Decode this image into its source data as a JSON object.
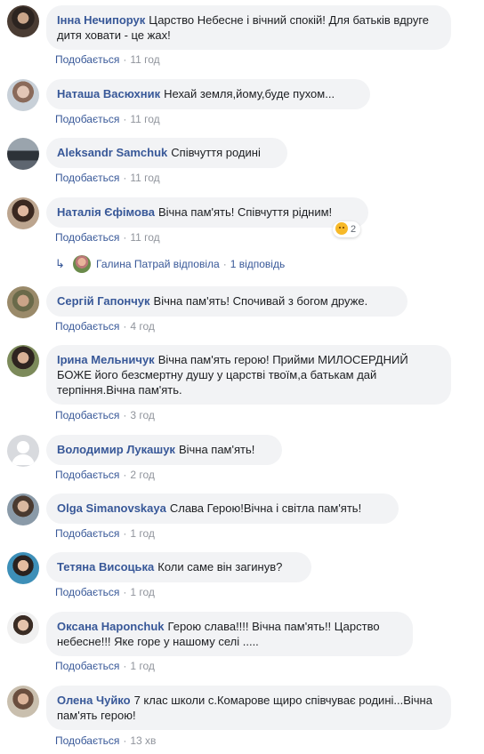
{
  "like_label": "Подобається",
  "separator": "·",
  "comments": [
    {
      "author": "Інна Нечипорук",
      "text": "Царство Небесне і вічний спокій! Для батьків вдруге дитя ховати - це жах!",
      "time": "11 год",
      "avatar": "avatar-inna"
    },
    {
      "author": "Наташа Васюхник",
      "text": "Нехай земля,йому,буде пухом...",
      "time": "11 год",
      "avatar": "avatar-natasha"
    },
    {
      "author": "Aleksandr Samchuk",
      "text": "Співчуття родині",
      "time": "11 год",
      "avatar": "avatar-aleksandr"
    },
    {
      "author": "Наталія Єфімова",
      "text": "Вічна пам'ять! Співчуття рідним!",
      "time": "11 год",
      "avatar": "avatar-natalia",
      "reactions": "2",
      "reaction_icon": "sad-face-icon"
    },
    {
      "author": "Сергій Гапончук",
      "text": "Вічна пам'ять! Спочивай з богом друже.",
      "time": "4 год",
      "avatar": "avatar-serhii"
    },
    {
      "author": "Ірина Мельничук",
      "text": "Вічна пам'ять герою! Прийми МИЛОСЕРДНИЙ БОЖЕ його безсмертну душу у царстві твоїм,а батькам дай терпіння.Вічна пам'ять.",
      "time": "3 год",
      "avatar": "avatar-iryna"
    },
    {
      "author": "Володимир Лукашук",
      "text": "Вічна пам'ять!",
      "time": "2 год",
      "avatar": "avatar-volodymyr"
    },
    {
      "author": "Olga Simanovskaya",
      "text": "Слава Герою!Вічна і світла пам'ять!",
      "time": "1 год",
      "avatar": "avatar-olga"
    },
    {
      "author": "Тетяна Висоцька",
      "text": "Коли саме він загинув?",
      "time": "1 год",
      "avatar": "avatar-tetiana"
    },
    {
      "author": "Оксана Haponchuk",
      "text": "Герою слава!!!! Вічна пам'ять!! Царство небесне!!! Яке горе у нашому селі .....",
      "time": "1 год",
      "avatar": "avatar-oksana"
    },
    {
      "author": "Олена Чуйко",
      "text": "7 клас школи с.Комарове щиро співчуває родині...Вічна пам'ять герою!",
      "time": "13 хв",
      "avatar": "avatar-olena"
    }
  ],
  "reply": {
    "author": "Галина Патрай",
    "action": "відповіла",
    "count_label": "1 відповідь"
  }
}
